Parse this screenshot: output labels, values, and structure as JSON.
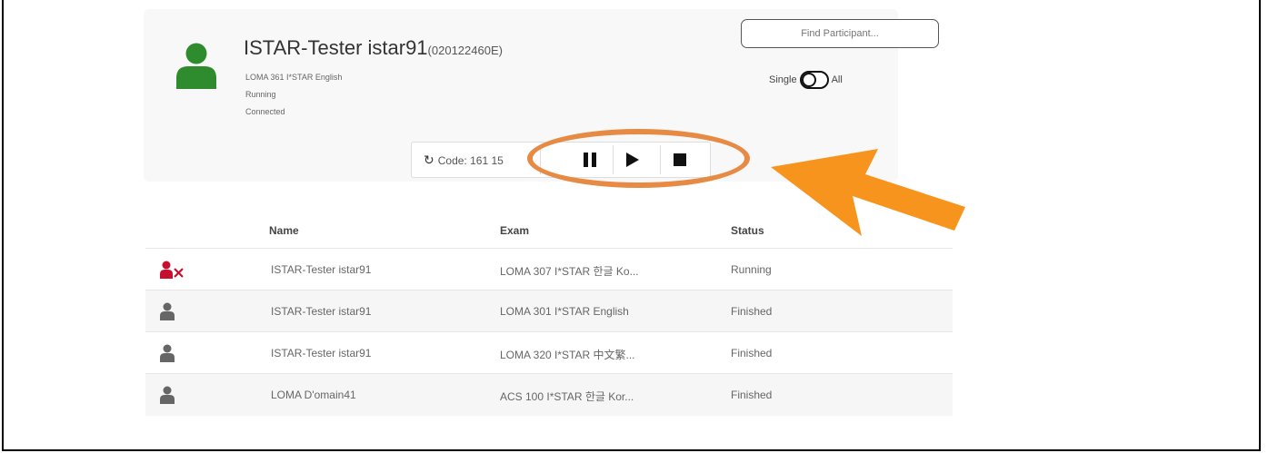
{
  "participant": {
    "name": "ISTAR-Tester istar91",
    "id": "(020122460E)",
    "exam": "LOMA 361 I*STAR English",
    "state": "Running",
    "connection": "Connected",
    "avatar_color": "#2e8b2e"
  },
  "search": {
    "placeholder": "Find Participant..."
  },
  "toggle": {
    "left_label": "Single",
    "right_label": "All"
  },
  "controls": {
    "code_label": "Code: 161",
    "code_tail": "15",
    "buttons": [
      "pause-icon",
      "play-icon",
      "stop-icon"
    ]
  },
  "annotation": {
    "color": "#f7941d",
    "ellipse_color": "#e68a44"
  },
  "table": {
    "headers": {
      "name": "Name",
      "exam": "Exam",
      "status": "Status"
    },
    "rows": [
      {
        "icon": "user-disconnected-icon",
        "name": "ISTAR-Tester istar91",
        "exam": "LOMA 307 I*STAR 한글 Ko...",
        "status": "Running"
      },
      {
        "icon": "user-icon",
        "name": "ISTAR-Tester istar91",
        "exam": "LOMA 301 I*STAR English",
        "status": "Finished"
      },
      {
        "icon": "user-icon",
        "name": "ISTAR-Tester istar91",
        "exam": "LOMA 320 I*STAR 中文繁...",
        "status": "Finished"
      },
      {
        "icon": "user-icon",
        "name": "LOMA D'omain41",
        "exam": "ACS 100 I*STAR 한글 Kor...",
        "status": "Finished"
      }
    ],
    "disconnected_color": "#c8102e",
    "user_color": "#666666"
  }
}
